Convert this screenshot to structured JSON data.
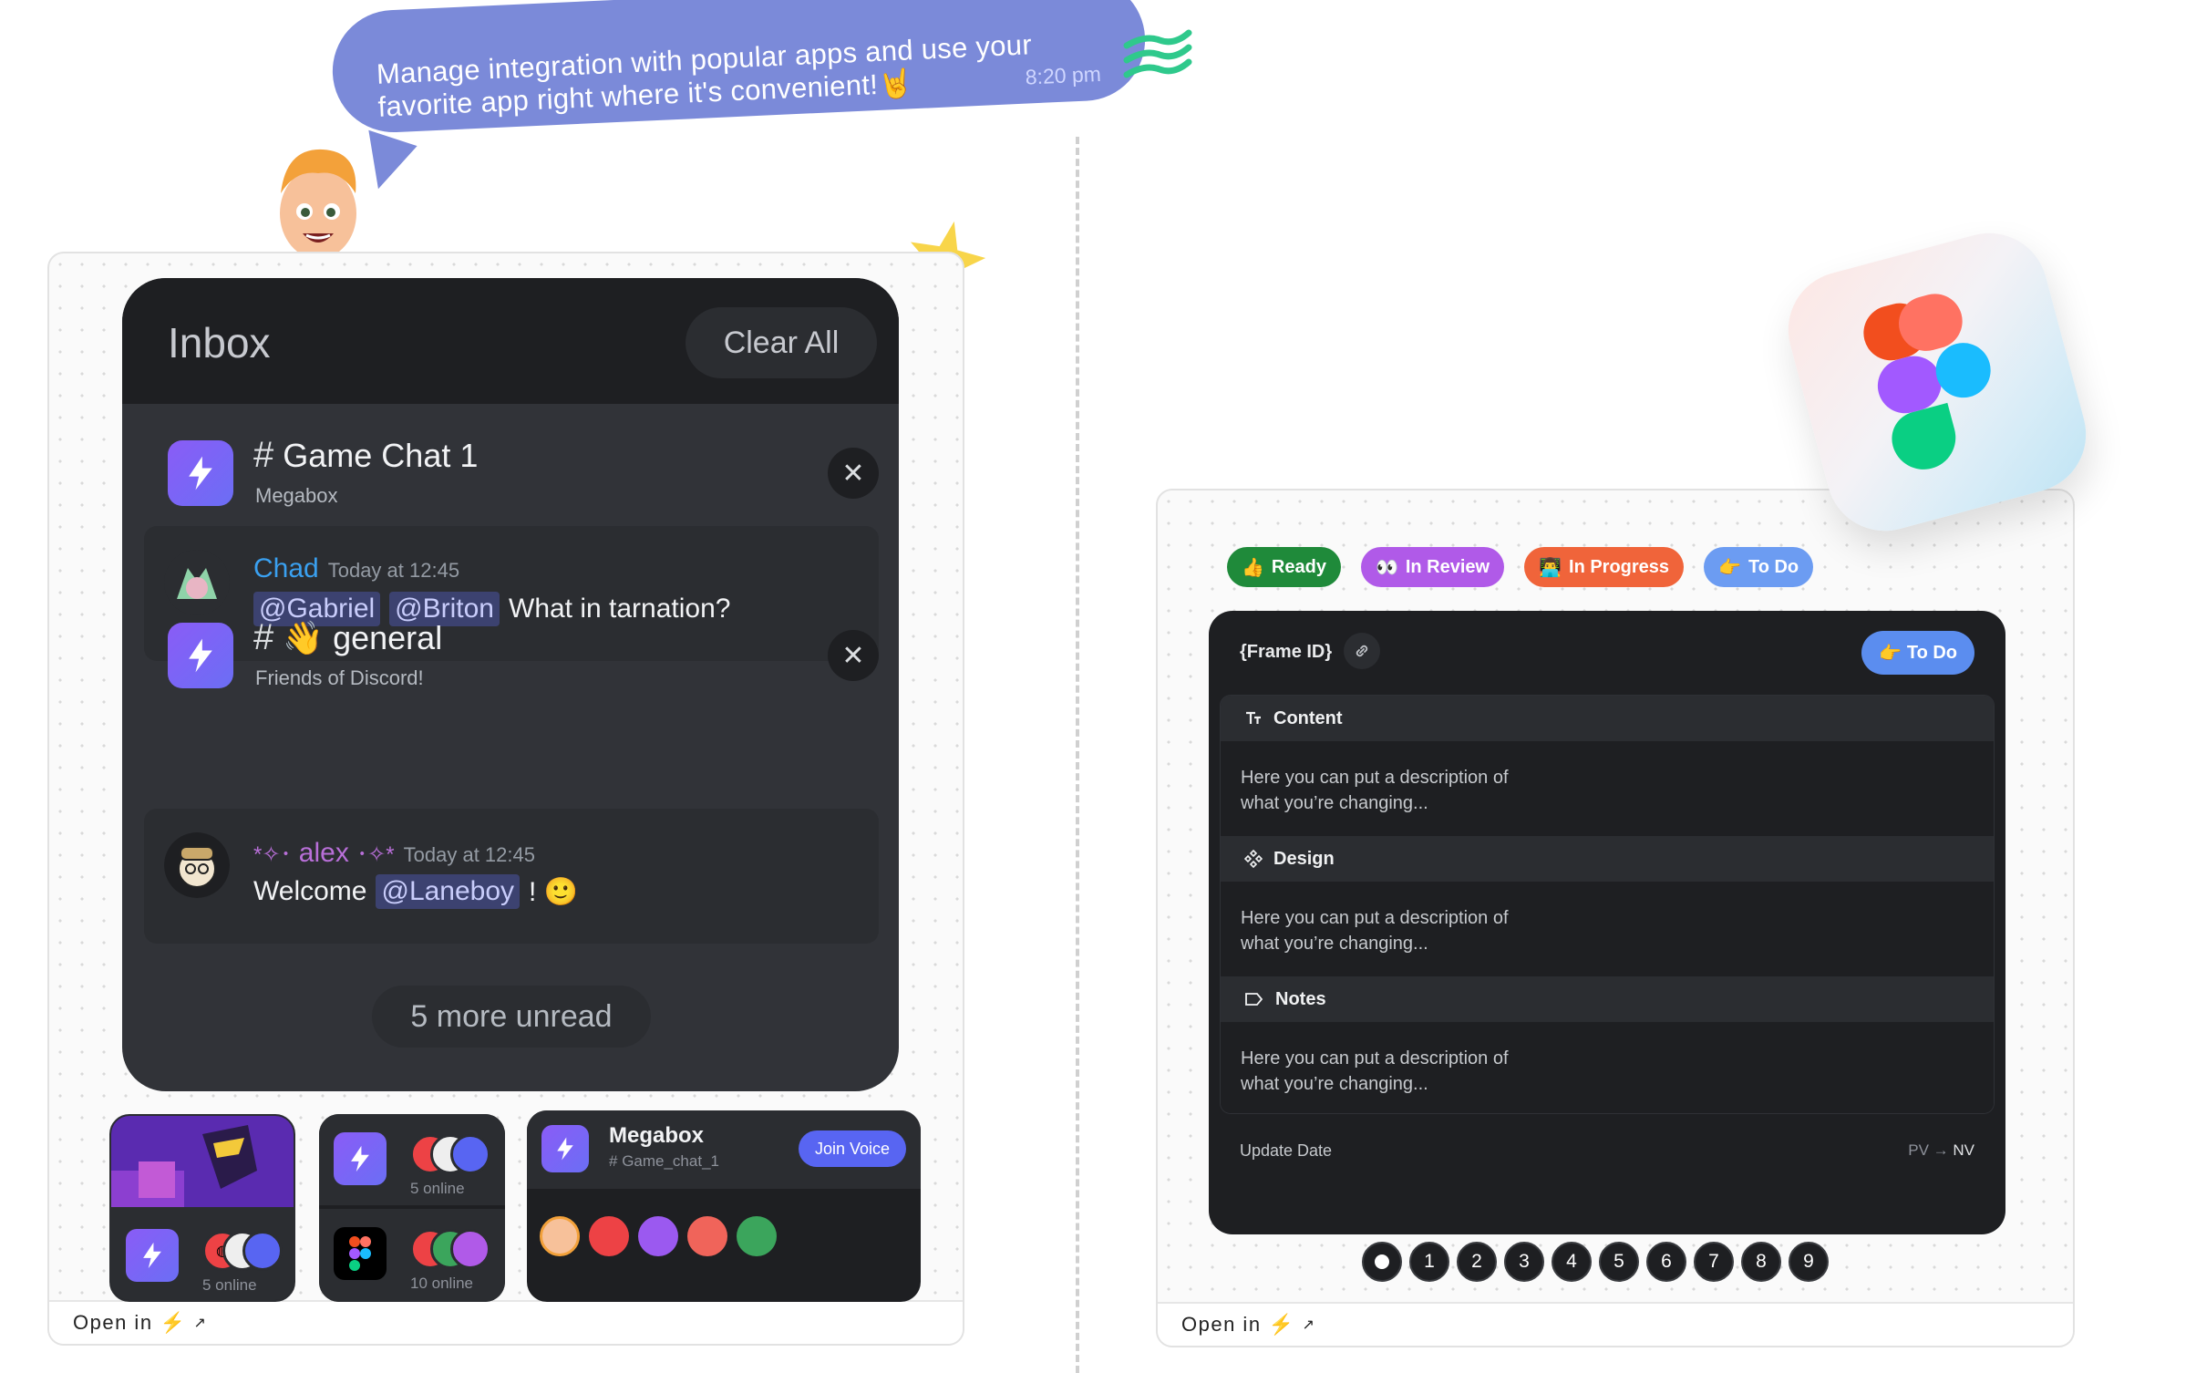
{
  "bubble": {
    "text": "Manage integration with popular apps and use your favorite app right where it's convenient!🤘",
    "time": "8:20 pm"
  },
  "inbox": {
    "title": "Inbox",
    "clear_all": "Clear All",
    "channels": [
      {
        "name": "Game Chat 1",
        "server": "Megabox",
        "message": {
          "author": "Chad",
          "time": "Today at 12:45",
          "mentions": [
            "@Gabriel",
            "@Briton"
          ],
          "text": "What in tarnation?",
          "author_color": "#3aa0f0"
        }
      },
      {
        "name": "👋 general",
        "server": "Friends of  Discord!",
        "message": {
          "author_prefix": "*✧･",
          "author": "alex",
          "author_suffix": "･✧*",
          "time": "Today at 12:45",
          "text_before": "Welcome",
          "mentions": [
            "@Laneboy"
          ],
          "text_after": "! 🙂",
          "author_color": "#b86fd8"
        }
      }
    ],
    "more_unread": "5 more unread"
  },
  "widgets": {
    "w1": {
      "online": "5 online"
    },
    "w2": {
      "online_top": "5 online",
      "online_bottom": "10 online"
    },
    "w3": {
      "server": "Megabox",
      "channel": "Game_chat_1",
      "join": "Join Voice"
    }
  },
  "left_footer": {
    "open_in": "Open in"
  },
  "right_footer": {
    "open_in": "Open in"
  },
  "tags": [
    {
      "emoji": "👍",
      "label": "Ready",
      "color": "#1f8a3a"
    },
    {
      "emoji": "👀",
      "label": "In Review",
      "color": "#b05ae8"
    },
    {
      "emoji": "👨‍💻",
      "label": "In Progress",
      "color": "#f0643a"
    },
    {
      "emoji": "👉",
      "label": "To Do",
      "color": "#6c9cf2"
    }
  ],
  "panel": {
    "frame_id": "{Frame ID}",
    "status": "To Do",
    "sections": [
      {
        "icon": "text-icon",
        "title": "Content",
        "body_1": "Here you can put a description of",
        "body_2": "what you’re changing..."
      },
      {
        "icon": "component-icon",
        "title": "Design",
        "body_1": "Here you can put a description of",
        "body_2": "what you’re changing..."
      },
      {
        "icon": "tag-icon",
        "title": "Notes",
        "body_1": "Here you can put a description of",
        "body_2": "what you’re changing..."
      }
    ],
    "update_date": "Update Date",
    "pv": "PV",
    "nv": "NV"
  },
  "pager": [
    "",
    "1",
    "2",
    "3",
    "4",
    "5",
    "6",
    "7",
    "8",
    "9"
  ]
}
